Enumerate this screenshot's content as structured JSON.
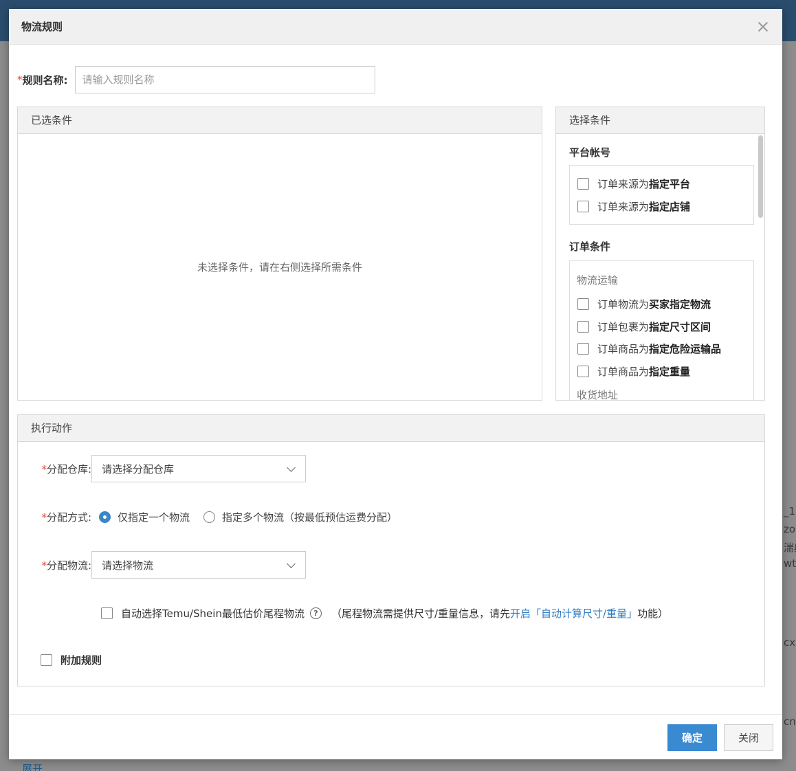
{
  "background": {
    "fragments": [
      "_1",
      "zo",
      "湍典",
      "wt",
      "cxs",
      "cn"
    ],
    "bottom_link": "展开"
  },
  "modal": {
    "title": "物流规则",
    "close_label": "×"
  },
  "name_field": {
    "required_mark": "*",
    "label": "规则名称:",
    "placeholder": "请输入规则名称",
    "value": ""
  },
  "selected_panel": {
    "title": "已选条件",
    "empty_hint": "未选择条件，请在右侧选择所需条件"
  },
  "choose_panel": {
    "title": "选择条件",
    "platform_section": {
      "title": "平台帐号",
      "items": [
        {
          "prefix": "订单来源为",
          "bold": "指定平台"
        },
        {
          "prefix": "订单来源为",
          "bold": "指定店铺"
        }
      ]
    },
    "order_section": {
      "title": "订单条件",
      "subgroup_logistics": "物流运输",
      "items": [
        {
          "prefix": "订单物流为",
          "bold": "买家指定物流"
        },
        {
          "prefix": "订单包裹为",
          "bold": "指定尺寸区间"
        },
        {
          "prefix": "订单商品为",
          "bold": "指定危险运输品"
        },
        {
          "prefix": "订单商品为",
          "bold": "指定重量"
        }
      ],
      "subgroup_address": "收货地址"
    }
  },
  "action_panel": {
    "title": "执行动作",
    "warehouse": {
      "required_mark": "*",
      "label": "分配仓库:",
      "placeholder": "请选择分配仓库"
    },
    "method": {
      "required_mark": "*",
      "label": "分配方式:",
      "option_single": "仅指定一个物流",
      "option_multi": "指定多个物流（按最低预估运费分配）",
      "selected": "single"
    },
    "logistics": {
      "required_mark": "*",
      "label": "分配物流:",
      "placeholder": "请选择物流"
    },
    "auto_select": {
      "label": "自动选择Temu/Shein最低估价尾程物流",
      "help_icon": "?",
      "note_prefix": "（尾程物流需提供尺寸/重量信息，请先",
      "note_link": "开启「自动计算尺寸/重量」",
      "note_suffix": "功能）"
    },
    "extra_rule": {
      "label": "附加规则"
    }
  },
  "footer": {
    "confirm_label": "确定",
    "close_label": "关闭"
  },
  "colors": {
    "primary": "#3a8ad2",
    "required": "#e74c3c",
    "link": "#2f7bc2",
    "header_bg": "#2a4d6e"
  }
}
